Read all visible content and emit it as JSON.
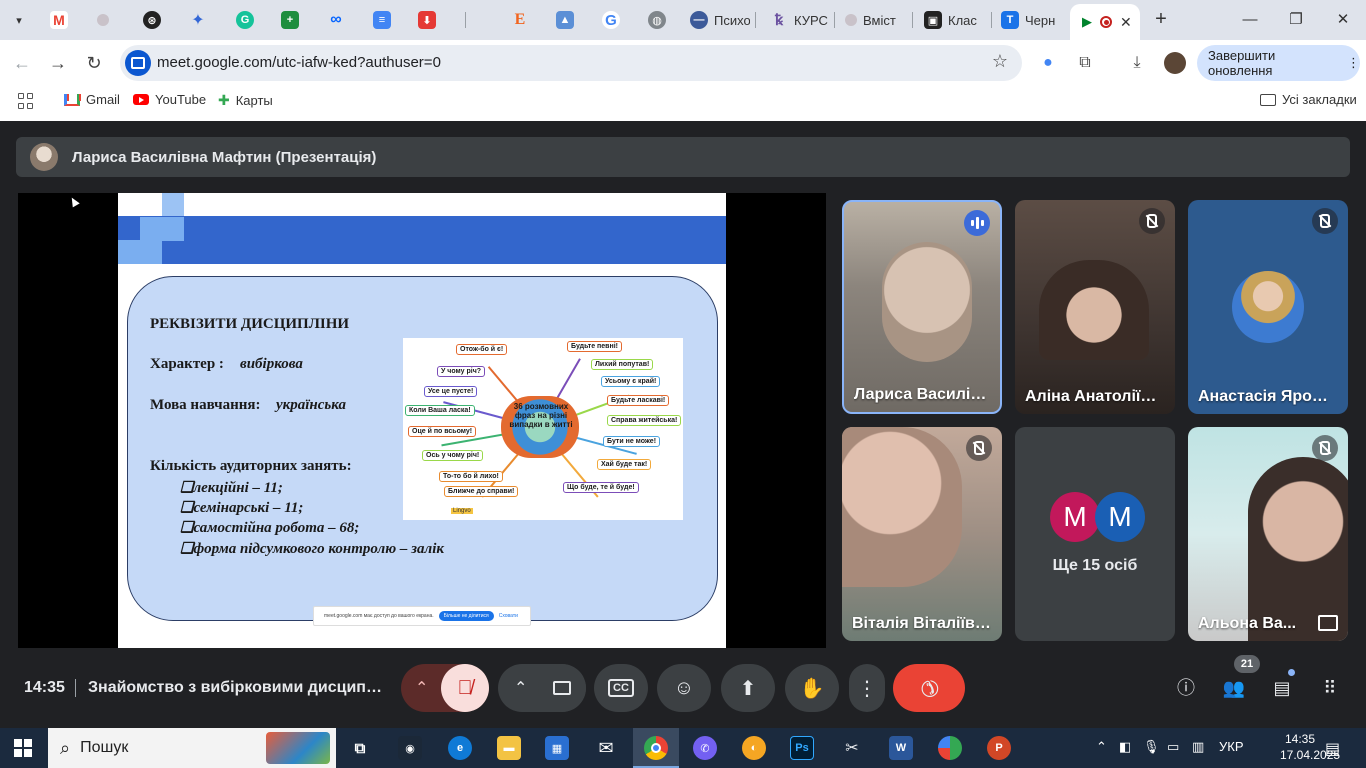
{
  "browser": {
    "tabs": [
      {
        "label": "",
        "icon": "gmail-icon"
      },
      {
        "label": "",
        "icon": "circle-icon"
      },
      {
        "label": "",
        "icon": "chatgpt-icon"
      },
      {
        "label": "",
        "icon": "gemini-icon"
      },
      {
        "label": "",
        "icon": "grammarly-icon"
      },
      {
        "label": "",
        "icon": "sheets-plus-icon"
      },
      {
        "label": "",
        "icon": "meta-icon"
      },
      {
        "label": "",
        "icon": "docs-icon"
      },
      {
        "label": "",
        "icon": "download-icon"
      },
      {
        "label": "",
        "icon": "etsy-icon"
      },
      {
        "label": "",
        "icon": "image-icon"
      },
      {
        "label": "",
        "icon": "google-icon"
      },
      {
        "label": "",
        "icon": "globe-icon"
      },
      {
        "label": "Психо",
        "icon": "blue-circle-icon"
      },
      {
        "label": "КУРС",
        "icon": "k-icon"
      },
      {
        "label": "Вміст",
        "icon": "circle-icon"
      },
      {
        "label": "Клас",
        "icon": "classroom-icon"
      },
      {
        "label": "Черн",
        "icon": "calendar-icon"
      }
    ],
    "url": "meet.google.com/utc-iafw-ked?authuser=0",
    "update_button": "Завершити оновлення",
    "bookmarks": [
      {
        "label": "Gmail"
      },
      {
        "label": "YouTube"
      },
      {
        "label": "Карты"
      }
    ],
    "all_bookmarks": "Усі закладки"
  },
  "meet": {
    "presenter_title": "Лариса Василівна Мафтин (Презентація)",
    "slide": {
      "heading": "РЕКВІЗИТИ ДИСЦИПЛІНИ",
      "character_label": "Характер :",
      "character_value": "вибіркова",
      "language_label": "Мова навчання:",
      "language_value": "українська",
      "hours_label": "Кількість аудиторних занять:",
      "items": [
        "❑лекційні – 11;",
        "❑семінарські – 11;",
        "❑самостійна робота – 68;",
        "❑форма підсумкового контролю – залік"
      ],
      "mindmap": {
        "center": "36 розмовних фраз на різні випадки в житті",
        "nodes": [
          "Отож-бо й є!",
          "Будьте певні!",
          "Лихий попутав!",
          "У чому річ?",
          "Усьому є край!",
          "Усе це пусте!",
          "Будьте ласкаві!",
          "Коли Ваша ласка!",
          "Справа житейська!",
          "Оце й по всьому!",
          "Бути не може!",
          "Ось у чому річ!",
          "Хай буде так!",
          "То-то бо й лихо!",
          "Ближче до справи!",
          "Що буде, те й буде!"
        ],
        "brand": "Lingvo"
      },
      "share_notice": "meet.google.com має доступ до вашого екрана.",
      "share_stop": "Більше не ділитися",
      "share_hide": "Сховати"
    },
    "participants": [
      {
        "name": "Лариса Василівна Мафтин",
        "status": "speaking"
      },
      {
        "name": "Аліна Анатоліївна",
        "status": "muted"
      },
      {
        "name": "Анастасія Ярошенко",
        "status": "muted"
      },
      {
        "name": "Віталія Віталіївна",
        "status": "muted"
      },
      {
        "name": "Альона Ва...",
        "status": "muted"
      }
    ],
    "others": {
      "initials": [
        "M",
        "M"
      ],
      "label": "Ще 15 осіб"
    },
    "time": "14:35",
    "meeting_title": "Знайомство з вибірковими дисциплінами",
    "participant_count": "21",
    "colors": {
      "end_call": "#ea4335",
      "mic_off_bg": "#f9dedc",
      "mic_off_icon": "#c5221f",
      "accent": "#8ab4f8",
      "initial_1": "#c2185b",
      "initial_2": "#1a5fb4"
    }
  },
  "taskbar": {
    "search_placeholder": "Пошук",
    "language": "УКР",
    "time": "14:35",
    "date": "17.04.2025"
  }
}
